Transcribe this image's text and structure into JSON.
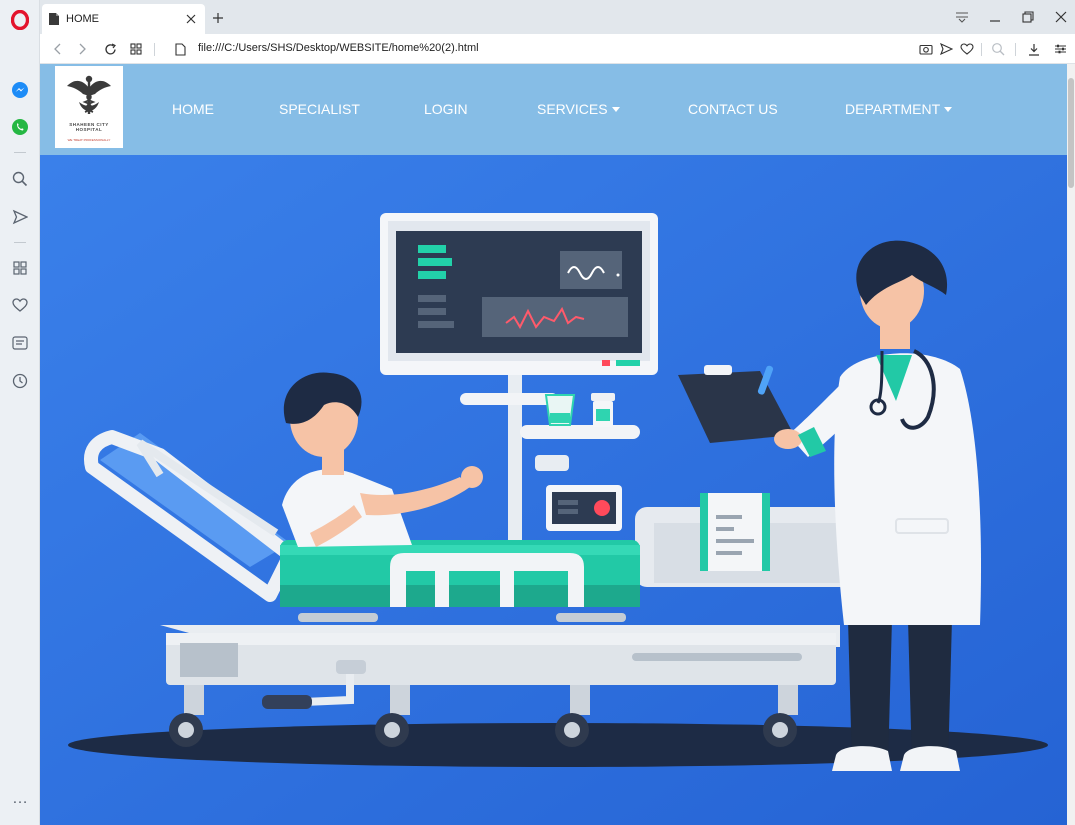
{
  "browser": {
    "tab": {
      "title": "HOME"
    },
    "address_bar": {
      "url": "file:///C:/Users/SHS/Desktop/WEBSITE/home%20(2).html"
    },
    "sidebar_icons": [
      "opera-logo",
      "messenger-icon",
      "whatsapp-icon",
      "search-icon",
      "send-icon",
      "speed-dial-icon",
      "heart-icon",
      "news-icon",
      "history-icon",
      "more-icon"
    ],
    "more_label": "…"
  },
  "site": {
    "logo": {
      "name_line1": "SHAHEEN CITY",
      "name_line2": "HOSPITAL",
      "tagline": "WE TREAT PROFESSIONALLY"
    },
    "nav": {
      "home": "HOME",
      "specialist": "SPECIALIST",
      "login": "LOGIN",
      "services": "SERVICES",
      "contact": "CONTACT US",
      "department": "DEPARTMENT"
    },
    "colors": {
      "navbar": "#86bde6",
      "hero_bg": "#2d72e0",
      "accent_teal": "#22c9a6"
    }
  }
}
